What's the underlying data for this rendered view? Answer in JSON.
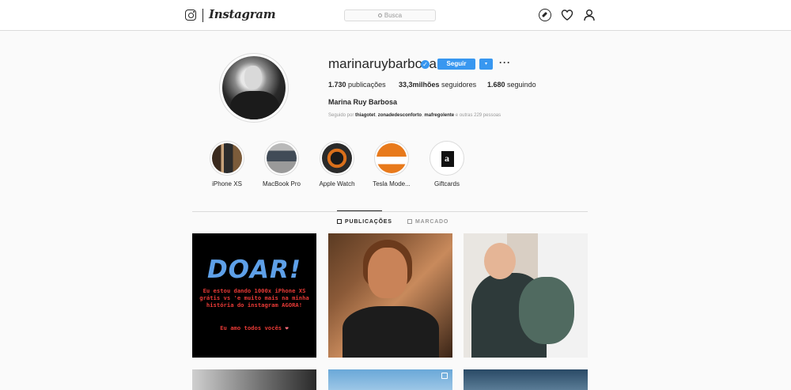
{
  "header": {
    "wordmark": "Instagram",
    "search_placeholder": "Busca"
  },
  "profile": {
    "username": "marinaruybarbosa",
    "verified": true,
    "follow_label": "Seguir",
    "dropdown_glyph": "▾",
    "more_glyph": "···",
    "stats": {
      "posts_value": "1.730",
      "posts_label": "publicações",
      "followers_value": "33,3milhões",
      "followers_label": "seguidores",
      "following_value": "1.680",
      "following_label": "seguindo"
    },
    "full_name": "Marina Ruy Barbosa",
    "followed_by": {
      "prefix": "Seguido por",
      "users": [
        "thiagotet",
        "zonadedesconforto",
        "mafregolente"
      ],
      "suffix": "e outras 229 pessoas"
    }
  },
  "highlights": [
    {
      "label": "iPhone XS"
    },
    {
      "label": "MacBook Pro"
    },
    {
      "label": "Apple Watch"
    },
    {
      "label": "Tesla Mode..."
    },
    {
      "label": "Giftcards"
    }
  ],
  "tabs": {
    "posts": "PUBLICAÇÕES",
    "tagged": "MARCADO"
  },
  "posts": {
    "first": {
      "headline": "DOAR!",
      "body": "Eu estou dando 1000x iPhone XS grátis vs 'e muito mais na minha história do instagram AGORA!",
      "footer": "Eu amo todos vocês",
      "heart": "❤"
    }
  },
  "colors": {
    "accent": "#3897f0",
    "doar_blue": "#5ea0e8",
    "doar_red": "#e53935"
  }
}
